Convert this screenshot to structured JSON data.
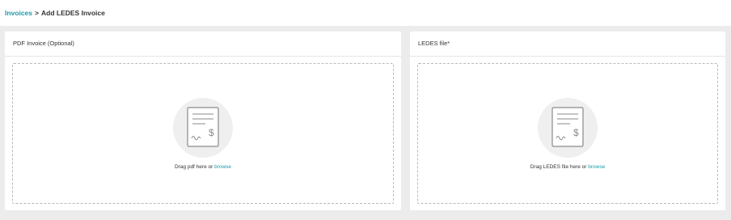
{
  "breadcrumb": {
    "parent": "Invoices",
    "separator": ">",
    "current": "Add LEDES Invoice"
  },
  "pdf_panel": {
    "title": "PDF Invoice (Optional)",
    "drop_text": "Drag pdf here or",
    "browse_label": "browse"
  },
  "ledes_panel": {
    "title": "LEDES file*",
    "drop_text": "Drag LEDES file here or",
    "browse_label": "browse"
  },
  "icons": {
    "document": "invoice-document-icon"
  },
  "colors": {
    "accent": "#1b9aaa",
    "background": "#ececec",
    "panel": "#ffffff"
  }
}
